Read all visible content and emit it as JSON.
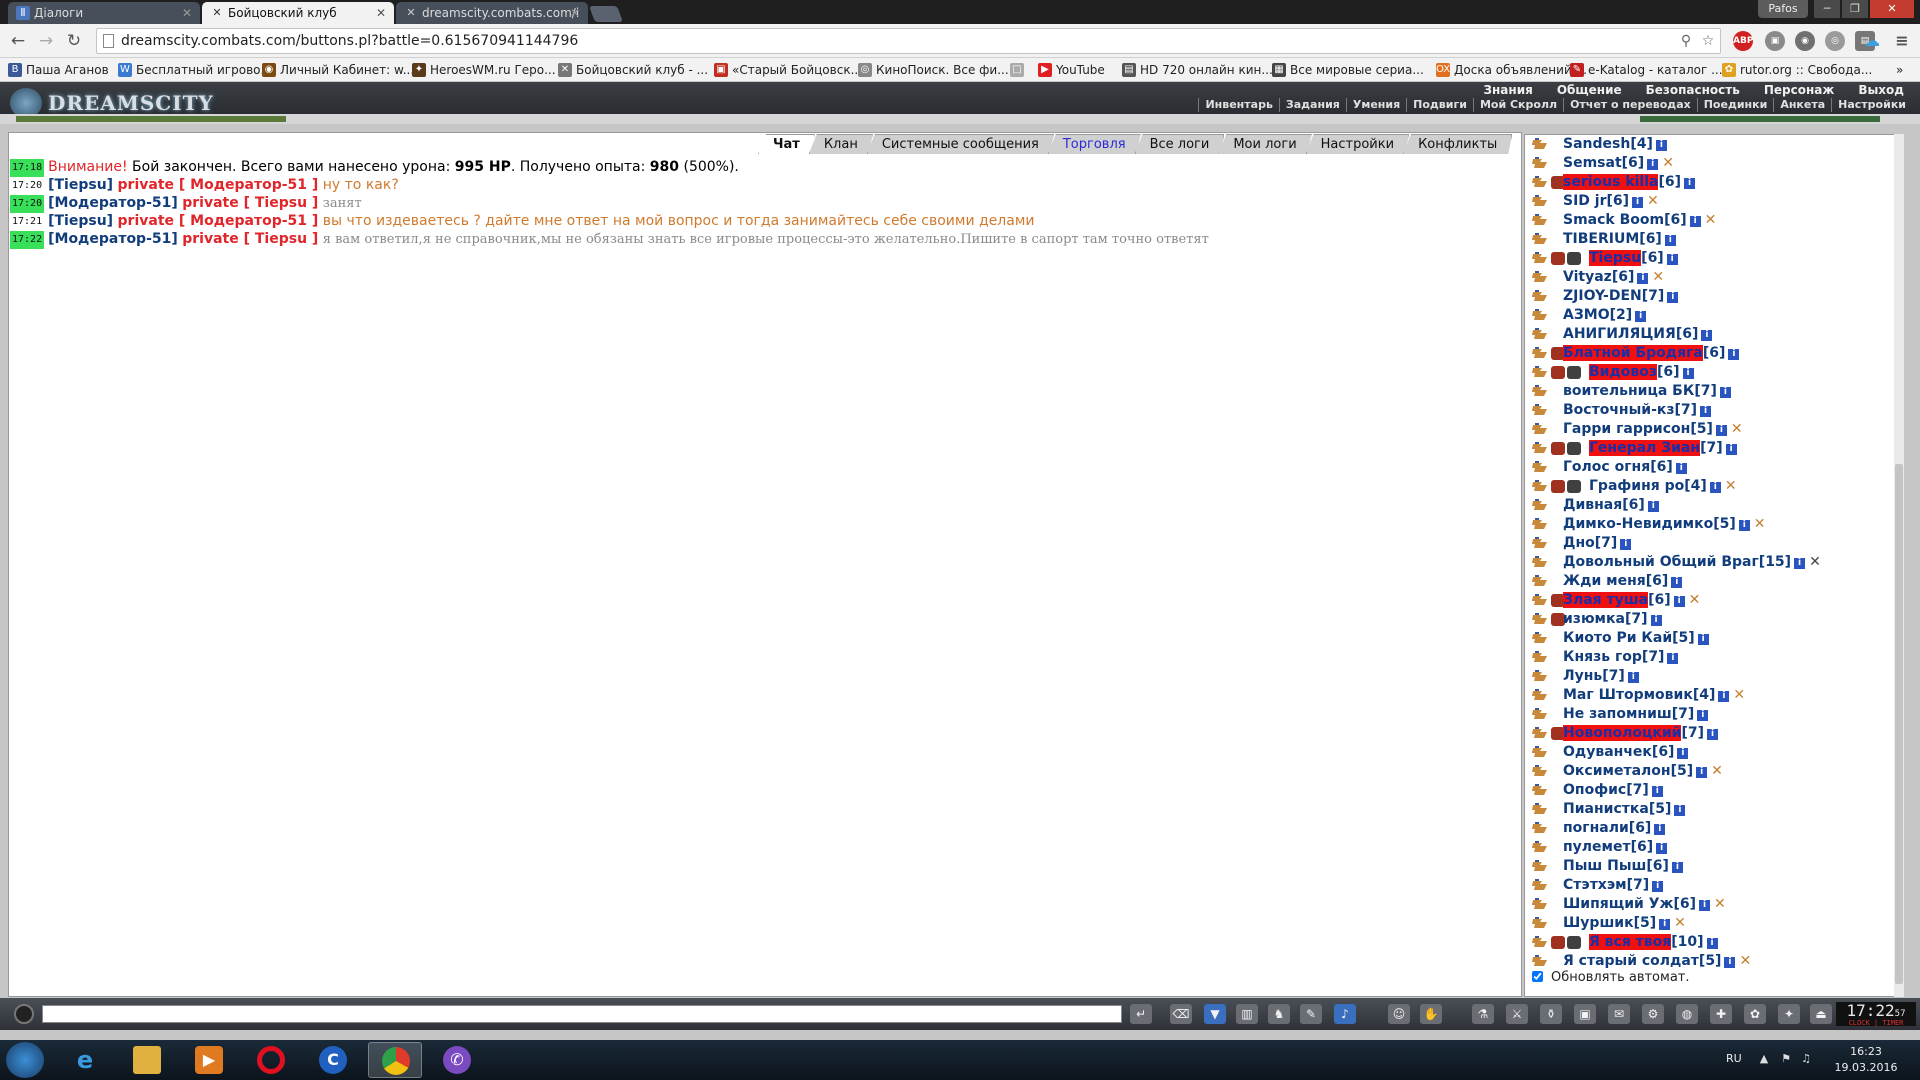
{
  "browser": {
    "tabs": [
      {
        "title": "Діалоги",
        "icon": "dialogs-icon",
        "active": false
      },
      {
        "title": "Бойцовский клуб",
        "icon": "swords-icon",
        "active": true
      },
      {
        "title": "dreamscity.combats.com/i",
        "icon": "swords-icon",
        "active": false
      }
    ],
    "profile": "Pafos",
    "url": "dreamscity.combats.com/buttons.pl?battle=0.615670941144796",
    "bookmarks": [
      {
        "label": "Паша Аганов",
        "icon_color": "#3b5998",
        "glyph": "B"
      },
      {
        "label": "Бесплатный игрово...",
        "icon_color": "#3a7ad0",
        "glyph": "W"
      },
      {
        "label": "Личный Кабинет: w...",
        "icon_color": "#7a4a10",
        "glyph": "◉"
      },
      {
        "label": "HeroesWM.ru Геро...",
        "icon_color": "#5a3a1a",
        "glyph": "✦"
      },
      {
        "label": "Бойцовский клуб - ...",
        "icon_color": "#777777",
        "glyph": "✕"
      },
      {
        "label": "«Старый Бойцовск...",
        "icon_color": "#c03020",
        "glyph": "▣"
      },
      {
        "label": "КиноПоиск. Все фи...",
        "icon_color": "#888888",
        "glyph": "◎"
      },
      {
        "label": "",
        "icon_color": "#aaaaaa",
        "glyph": "□"
      },
      {
        "label": "YouTube",
        "icon_color": "#e02020",
        "glyph": "▶"
      },
      {
        "label": "HD 720 онлайн кин...",
        "icon_color": "#555555",
        "glyph": "▤"
      },
      {
        "label": "Все мировые сериа...",
        "icon_color": "#444444",
        "glyph": "▦"
      },
      {
        "label": "Доска объявлений ...",
        "icon_color": "#e07020",
        "glyph": "OX"
      },
      {
        "label": "e-Katalog - каталог ...",
        "icon_color": "#c02020",
        "glyph": "✎"
      },
      {
        "label": "rutor.org :: Свобода...",
        "icon_color": "#e0a020",
        "glyph": "✿"
      }
    ]
  },
  "game": {
    "logo": "DREAMSCITY",
    "top_menu": [
      "Знания",
      "Общение",
      "Безопасность",
      "Персонаж",
      "Выход"
    ],
    "sub_menu": [
      "Инвентарь",
      "Задания",
      "Умения",
      "Подвиги",
      "Мой Скролл",
      "Отчет о переводах",
      "Поединки",
      "Анкета",
      "Настройки"
    ],
    "hp_left": 0.27,
    "hp_right": 0.24
  },
  "chat": {
    "tabs": [
      {
        "label": "Чат",
        "active": true
      },
      {
        "label": "Клан"
      },
      {
        "label": "Системные сообщения"
      },
      {
        "label": "Торговля",
        "trade": true
      },
      {
        "label": "Все логи"
      },
      {
        "label": "Мои логи"
      },
      {
        "label": "Настройки"
      },
      {
        "label": "Конфликты"
      }
    ],
    "lines": [
      {
        "time": "17:18",
        "hl": true,
        "type": "system",
        "parts": [
          [
            "warn",
            "Внимание!"
          ],
          [
            "plain",
            " Бой закончен. Всего вами нанесено урона: "
          ],
          [
            "bold",
            "995 HP"
          ],
          [
            "plain",
            ". Получено опыта: "
          ],
          [
            "bold",
            "980"
          ],
          [
            "plain",
            " (500%)."
          ]
        ]
      },
      {
        "time": "17:20",
        "hl": false,
        "type": "private",
        "from": "[Tiepsu]",
        "to": "private [ Модератор-51 ]",
        "text": "ну то как?",
        "style": "msg-orange"
      },
      {
        "time": "17:20",
        "hl": true,
        "type": "private",
        "from": "[Модератор-51]",
        "to": "private [ Tiepsu ]",
        "text": "занят",
        "style": "msg-gray"
      },
      {
        "time": "17:21",
        "hl": false,
        "type": "private",
        "from": "[Tiepsu]",
        "to": "private [ Модератор-51 ]",
        "text": "вы что издеваетесь ? дайте мне ответ на мой вопрос и тогда занимайтесь себе своими делами",
        "style": "msg-orange"
      },
      {
        "time": "17:22",
        "hl": true,
        "type": "private",
        "from": "[Модератор-51]",
        "to": "private [ Tiepsu ]",
        "text": "я вам ответил,я не справочник,мы не обязаны знать все игровые процессы-это желательно.Пишите в сапорт там точно ответят",
        "style": "msg-gray"
      }
    ],
    "input_placeholder": ""
  },
  "users": [
    {
      "name": "Sandesh",
      "lvl": "[4]",
      "icon": "ship-icon"
    },
    {
      "name": "Semsat",
      "lvl": "[6]",
      "icon": "ship-icon",
      "x": true
    },
    {
      "name": "serious killa",
      "lvl": "[6]",
      "icon": "ship-icon",
      "hl": true,
      "badges": 1
    },
    {
      "name": "SID jr",
      "lvl": "[6]",
      "icon": "ship-icon",
      "x": true
    },
    {
      "name": "Smack Boom",
      "lvl": "[6]",
      "icon": "ship-icon",
      "x": true
    },
    {
      "name": "TIBERIUM",
      "lvl": "[6]",
      "icon": "ship-icon"
    },
    {
      "name": "Tiepsu",
      "lvl": "[6]",
      "icon": "ship-icon",
      "hl": true,
      "badges": 2
    },
    {
      "name": "Vityaz",
      "lvl": "[6]",
      "icon": "ship-icon",
      "x": true
    },
    {
      "name": "ZJIOY-DEN",
      "lvl": "[7]",
      "icon": "ship-icon"
    },
    {
      "name": "АЗМО",
      "lvl": "[2]",
      "icon": "ship-icon"
    },
    {
      "name": "АНИГИЛЯЦИЯ",
      "lvl": "[6]",
      "icon": "ship-icon"
    },
    {
      "name": "Блатной Бродяга",
      "lvl": "[6]",
      "icon": "ship-icon",
      "hl": true,
      "badges": 1
    },
    {
      "name": "Видовоз",
      "lvl": "[6]",
      "icon": "ship-icon",
      "hl": true,
      "badges": 2
    },
    {
      "name": "воительница БК",
      "lvl": "[7]",
      "icon": "ship-icon"
    },
    {
      "name": "Восточный-кз",
      "lvl": "[7]",
      "icon": "ship-icon"
    },
    {
      "name": "Гарри гаррисон",
      "lvl": "[5]",
      "icon": "ship-icon",
      "x": true
    },
    {
      "name": "Генерал Зиан",
      "lvl": "[7]",
      "icon": "ship-icon",
      "hl": true,
      "badges": 2
    },
    {
      "name": "Голос огня",
      "lvl": "[6]",
      "icon": "ship-icon"
    },
    {
      "name": "Графиня ро",
      "lvl": "[4]",
      "icon": "ship-icon",
      "x": true,
      "badges": 2
    },
    {
      "name": "Дивная",
      "lvl": "[6]",
      "icon": "ship-icon"
    },
    {
      "name": "Димко-Невидимко",
      "lvl": "[5]",
      "icon": "ship-icon",
      "x": true
    },
    {
      "name": "Дно",
      "lvl": "[7]",
      "icon": "ship-icon"
    },
    {
      "name": "Довольный Общий Враг",
      "lvl": "[15]",
      "icon": "ship-icon",
      "x": true,
      "xgray": true
    },
    {
      "name": "Жди меня",
      "lvl": "[6]",
      "icon": "ship-icon"
    },
    {
      "name": "Злая туша",
      "lvl": "[6]",
      "icon": "ship-icon",
      "hl": true,
      "x": true,
      "badges": 1
    },
    {
      "name": "изюмка",
      "lvl": "[7]",
      "icon": "ship-icon",
      "badges": 1
    },
    {
      "name": "Киото Ри Кай",
      "lvl": "[5]",
      "icon": "ship-icon"
    },
    {
      "name": "Князь гор",
      "lvl": "[7]",
      "icon": "ship-icon"
    },
    {
      "name": "Лунь",
      "lvl": "[7]",
      "icon": "ship-icon"
    },
    {
      "name": "Маг Штормовик",
      "lvl": "[4]",
      "icon": "ship-icon",
      "x": true
    },
    {
      "name": "Не запомниш",
      "lvl": "[7]",
      "icon": "ship-icon"
    },
    {
      "name": "Новополоцкий",
      "lvl": "[7]",
      "icon": "ship-icon",
      "hl": true,
      "badges": 1
    },
    {
      "name": "Одуванчек",
      "lvl": "[6]",
      "icon": "ship-icon"
    },
    {
      "name": "Оксиметалон",
      "lvl": "[5]",
      "icon": "ship-icon",
      "x": true
    },
    {
      "name": "Опофис",
      "lvl": "[7]",
      "icon": "ship-icon"
    },
    {
      "name": "Пианистка",
      "lvl": "[5]",
      "icon": "ship-icon"
    },
    {
      "name": "погнали",
      "lvl": "[6]",
      "icon": "ship-icon"
    },
    {
      "name": "пулемет",
      "lvl": "[6]",
      "icon": "ship-icon"
    },
    {
      "name": "Пыш Пыш",
      "lvl": "[6]",
      "icon": "ship-icon"
    },
    {
      "name": "Стэтхэм",
      "lvl": "[7]",
      "icon": "ship-icon"
    },
    {
      "name": "Шипящий Уж",
      "lvl": "[6]",
      "icon": "ship-icon",
      "x": true
    },
    {
      "name": "Шуршик",
      "lvl": "[5]",
      "icon": "ship-icon",
      "x": true
    },
    {
      "name": "Я вся твоя",
      "lvl": "[10]",
      "icon": "ship-icon",
      "hl": true,
      "badges": 2
    },
    {
      "name": "Я старый солдат",
      "lvl": "[5]",
      "icon": "ship-icon",
      "x": true
    }
  ],
  "auto_refresh_label": "Обновлять автомат.",
  "clock": {
    "time": "17:22",
    "sec": "57",
    "label": "CLOCK | TIMER"
  },
  "taskbar": {
    "lang": "RU",
    "time": "16:23",
    "date": "19.03.2016"
  },
  "colors": {
    "highlight_bg": "#f01010",
    "nick": "#123d7c",
    "private": "#e0262a",
    "timestamp_hl": "#38e05a"
  }
}
